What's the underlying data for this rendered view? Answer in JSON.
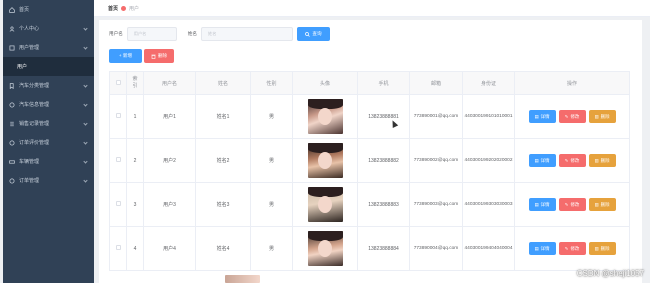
{
  "sidebar": {
    "items": [
      {
        "label": "首页",
        "icon": "home-icon"
      },
      {
        "label": "个人中心",
        "icon": "user-icon"
      },
      {
        "label": "用户管理",
        "icon": "users-icon"
      },
      {
        "label": "用户",
        "sub": true
      },
      {
        "label": "汽车分类管理",
        "icon": "tag-icon"
      },
      {
        "label": "汽车信息管理",
        "icon": "car-icon"
      },
      {
        "label": "销售记录管理",
        "icon": "list-icon"
      },
      {
        "label": "订单评价管理",
        "icon": "comment-icon"
      },
      {
        "label": "车辆管理",
        "icon": "truck-icon"
      },
      {
        "label": "订单管理",
        "icon": "order-icon"
      }
    ],
    "colors": {
      "bg": "#304156",
      "submenu_bg": "#1f2d3d",
      "text": "#c8d1dc"
    }
  },
  "breadcrumb": {
    "home": "首页",
    "current": "用户"
  },
  "search": {
    "label1": "用户名",
    "placeholder1": "用户名",
    "label2": "姓名",
    "placeholder2": "姓名",
    "button": "查询"
  },
  "actions": {
    "add": "+ 新增",
    "delete": "删除"
  },
  "table": {
    "headers": [
      "",
      "索引",
      "用户名",
      "姓名",
      "性别",
      "头像",
      "手机",
      "邮箱",
      "身份证",
      "操作"
    ],
    "rows": [
      {
        "index": "1",
        "username": "用户1",
        "name": "姓名1",
        "gender": "男",
        "phone": "13823888881",
        "email": "773890001@qq.com",
        "idcard": "440300199101010001"
      },
      {
        "index": "2",
        "username": "用户2",
        "name": "姓名2",
        "gender": "男",
        "phone": "13823888882",
        "email": "773890002@qq.com",
        "idcard": "440300199202020002"
      },
      {
        "index": "3",
        "username": "用户3",
        "name": "姓名3",
        "gender": "男",
        "phone": "13823888883",
        "email": "773890003@qq.com",
        "idcard": "440300199303030003"
      },
      {
        "index": "4",
        "username": "用户4",
        "name": "姓名4",
        "gender": "男",
        "phone": "13823888884",
        "email": "773890004@qq.com",
        "idcard": "440300199404040004"
      }
    ],
    "ops": {
      "detail": "详情",
      "edit": "修改",
      "remove": "删除"
    }
  },
  "watermark": "CSDN @sheji1057",
  "colors": {
    "primary": "#409eff",
    "danger": "#f56c6c",
    "warning": "#e6a23c"
  }
}
